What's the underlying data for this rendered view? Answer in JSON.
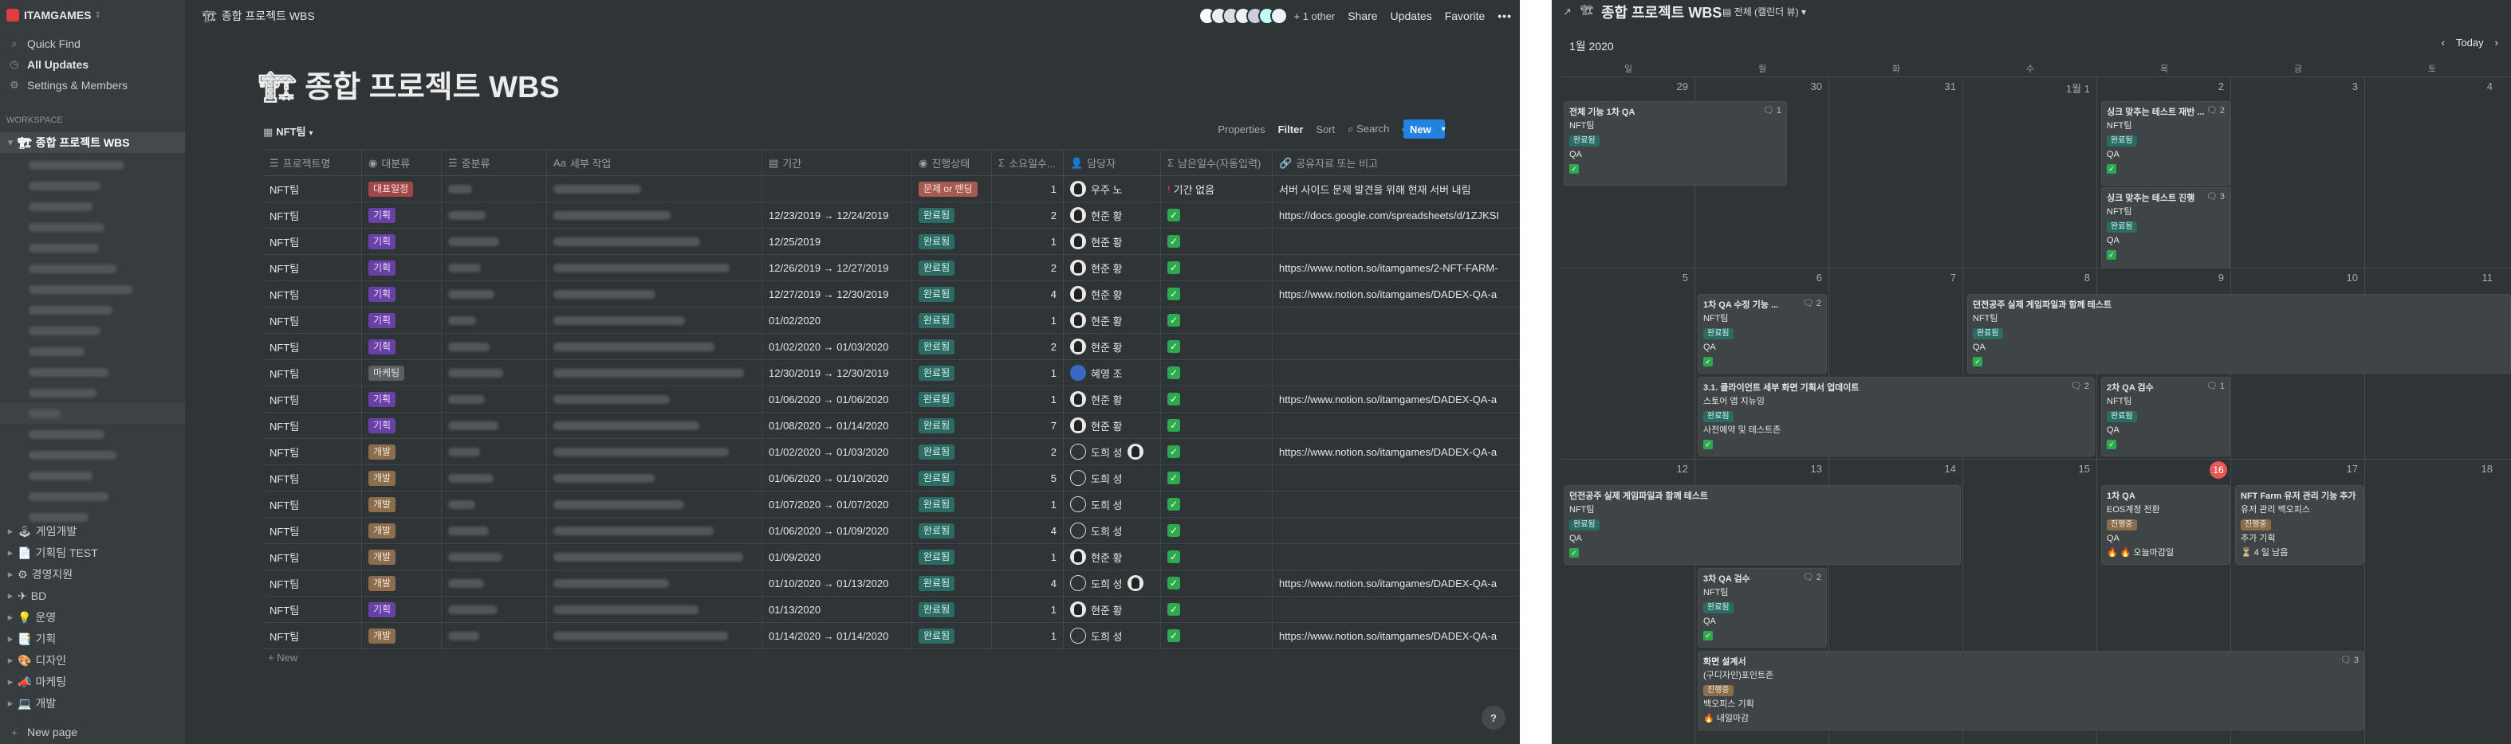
{
  "workspace": {
    "name": "ITAMGAMES"
  },
  "sidebar": {
    "quick_find": "Quick Find",
    "all_updates": "All Updates",
    "settings": "Settings & Members",
    "section_label": "WORKSPACE",
    "current_page": "종합 프로젝트 WBS",
    "pages": [
      {
        "label": "게임개발"
      },
      {
        "label": "기획팀 TEST"
      },
      {
        "label": "경영지원"
      },
      {
        "label": "BD"
      },
      {
        "label": "운영"
      },
      {
        "label": "기획"
      },
      {
        "label": "디자인"
      },
      {
        "label": "마케팅"
      },
      {
        "label": "개발"
      }
    ],
    "new_page": "New page"
  },
  "topbar": {
    "breadcrumb": "종합 프로젝트 WBS",
    "other_count": "+ 1 other",
    "share": "Share",
    "updates": "Updates",
    "favorite": "Favorite"
  },
  "page": {
    "title": "종합 프로젝트 WBS"
  },
  "view": {
    "name": "NFT팀",
    "properties": "Properties",
    "filter": "Filter",
    "sort": "Sort",
    "search": "Search",
    "new": "New"
  },
  "table": {
    "columns": [
      "프로젝트명",
      "대분류",
      "중분류",
      "세부 작업",
      "기간",
      "진행상태",
      "소요일수...",
      "담당자",
      "남은일수(자동입력)",
      "공유자료 또는 비고"
    ],
    "rows": [
      {
        "project": "NFT팀",
        "cat": "대표일정",
        "cat_style": "red",
        "period": "",
        "status": "문제 or 랜딩",
        "status_style": "prob",
        "days": "1",
        "owner": "우주 노",
        "owner_style": "dark",
        "remain": "기간 없음",
        "note": "서버 사이드 문제 발견을 위해 현재 서버 내림"
      },
      {
        "project": "NFT팀",
        "cat": "기획",
        "cat_style": "gi",
        "period": "12/23/2019 → 12/24/2019",
        "status": "완료됨",
        "status_style": "done",
        "days": "2",
        "owner": "현준 황",
        "owner_style": "dark",
        "remain": "",
        "note": "https://docs.google.com/spreadsheets/d/1ZJKSI"
      },
      {
        "project": "NFT팀",
        "cat": "기획",
        "cat_style": "gi",
        "period": "12/25/2019",
        "status": "완료됨",
        "status_style": "done",
        "days": "1",
        "owner": "현준 황",
        "owner_style": "dark",
        "remain": "",
        "note": ""
      },
      {
        "project": "NFT팀",
        "cat": "기획",
        "cat_style": "gi",
        "period": "12/26/2019 → 12/27/2019",
        "status": "완료됨",
        "status_style": "done",
        "days": "2",
        "owner": "현준 황",
        "owner_style": "dark",
        "remain": "",
        "note": "https://www.notion.so/itamgames/2-NFT-FARM-"
      },
      {
        "project": "NFT팀",
        "cat": "기획",
        "cat_style": "gi",
        "period": "12/27/2019 → 12/30/2019",
        "status": "완료됨",
        "status_style": "done",
        "days": "4",
        "owner": "현준 황",
        "owner_style": "dark",
        "remain": "",
        "note": "https://www.notion.so/itamgames/DADEX-QA-a"
      },
      {
        "project": "NFT팀",
        "cat": "기획",
        "cat_style": "gi",
        "period": "01/02/2020",
        "status": "완료됨",
        "status_style": "done",
        "days": "1",
        "owner": "현준 황",
        "owner_style": "dark",
        "remain": "",
        "note": ""
      },
      {
        "project": "NFT팀",
        "cat": "기획",
        "cat_style": "gi",
        "period": "01/02/2020 → 01/03/2020",
        "status": "완료됨",
        "status_style": "done",
        "days": "2",
        "owner": "현준 황",
        "owner_style": "dark",
        "remain": "",
        "note": ""
      },
      {
        "project": "NFT팀",
        "cat": "마케팅",
        "cat_style": "mk",
        "period": "12/30/2019 → 12/30/2019",
        "status": "완료됨",
        "status_style": "done",
        "days": "1",
        "owner": "혜영 조",
        "owner_style": "blue",
        "remain": "",
        "note": ""
      },
      {
        "project": "NFT팀",
        "cat": "기획",
        "cat_style": "gi",
        "period": "01/06/2020 → 01/06/2020",
        "status": "완료됨",
        "status_style": "done",
        "days": "1",
        "owner": "현준 황",
        "owner_style": "dark",
        "remain": "",
        "note": "https://www.notion.so/itamgames/DADEX-QA-a"
      },
      {
        "project": "NFT팀",
        "cat": "기획",
        "cat_style": "gi",
        "period": "01/08/2020 → 01/14/2020",
        "status": "완료됨",
        "status_style": "done",
        "days": "7",
        "owner": "현준 황",
        "owner_style": "dark",
        "remain": "",
        "note": ""
      },
      {
        "project": "NFT팀",
        "cat": "개발",
        "cat_style": "dev",
        "period": "01/02/2020 → 01/03/2020",
        "status": "완료됨",
        "status_style": "done",
        "days": "2",
        "owner": "도희 성",
        "owner_style": "out",
        "remain": "",
        "note": "https://www.notion.so/itamgames/DADEX-QA-a"
      },
      {
        "project": "NFT팀",
        "cat": "개발",
        "cat_style": "dev",
        "period": "01/06/2020 → 01/10/2020",
        "status": "완료됨",
        "status_style": "done",
        "days": "5",
        "owner": "도희 성",
        "owner_style": "out",
        "remain": "",
        "note": ""
      },
      {
        "project": "NFT팀",
        "cat": "개발",
        "cat_style": "dev",
        "period": "01/07/2020 → 01/07/2020",
        "status": "완료됨",
        "status_style": "done",
        "days": "1",
        "owner": "도희 성",
        "owner_style": "out",
        "remain": "",
        "note": ""
      },
      {
        "project": "NFT팀",
        "cat": "개발",
        "cat_style": "dev",
        "period": "01/06/2020 → 01/09/2020",
        "status": "완료됨",
        "status_style": "done",
        "days": "4",
        "owner": "도희 성",
        "owner_style": "out",
        "remain": "",
        "note": ""
      },
      {
        "project": "NFT팀",
        "cat": "개발",
        "cat_style": "dev",
        "period": "01/09/2020",
        "status": "완료됨",
        "status_style": "done",
        "days": "1",
        "owner": "현준 황",
        "owner_style": "dark",
        "remain": "",
        "note": ""
      },
      {
        "project": "NFT팀",
        "cat": "개발",
        "cat_style": "dev",
        "period": "01/10/2020 → 01/13/2020",
        "status": "완료됨",
        "status_style": "done",
        "days": "4",
        "owner": "도희 성",
        "owner_style": "out",
        "remain": "",
        "note": "https://www.notion.so/itamgames/DADEX-QA-a"
      },
      {
        "project": "NFT팀",
        "cat": "기획",
        "cat_style": "gi",
        "period": "01/13/2020",
        "status": "완료됨",
        "status_style": "done",
        "days": "1",
        "owner": "현준 황",
        "owner_style": "dark",
        "remain": "",
        "note": ""
      },
      {
        "project": "NFT팀",
        "cat": "개발",
        "cat_style": "dev",
        "period": "01/14/2020 → 01/14/2020",
        "status": "완료됨",
        "status_style": "done",
        "days": "1",
        "owner": "도희 성",
        "owner_style": "out",
        "remain": "",
        "note": "https://www.notion.so/itamgames/DADEX-QA-a"
      }
    ],
    "new_row": "+ New"
  },
  "calendar": {
    "breadcrumb": "종합 프로젝트 WBS",
    "view_name": "전체 (캘린더 뷰)",
    "month": "1월 2020",
    "today": "Today",
    "weekdays": [
      "일",
      "월",
      "화",
      "수",
      "목",
      "금",
      "토"
    ],
    "weeks": [
      [
        "29",
        "30",
        "31",
        "1월 1",
        "2",
        "3",
        "4"
      ],
      [
        "5",
        "6",
        "7",
        "8",
        "9",
        "10",
        "11"
      ],
      [
        "12",
        "13",
        "14",
        "15",
        "16",
        "17",
        "18"
      ]
    ],
    "cards": {
      "c1": {
        "title": "전체 기능 1차 QA",
        "team": "NFT팀",
        "status": "완료됨",
        "role": "QA",
        "comments": "1"
      },
      "c2": {
        "title": "싱크 맞추는 테스트 재반 ...",
        "team": "NFT팀",
        "status": "완료됨",
        "role": "QA",
        "comments": "2"
      },
      "c3": {
        "title": "싱크 맞추는 테스트 진행",
        "team": "NFT팀",
        "status": "완료됨",
        "role": "QA",
        "comments": "3"
      },
      "c4": {
        "title": "1차 QA 수정 기능 ...",
        "team": "NFT팀",
        "status": "완료됨",
        "role": "QA",
        "comments": "2"
      },
      "c5": {
        "title": "던전공주 실제 게임파일과 함께 테스트",
        "team": "NFT팀",
        "status": "완료됨",
        "role": "QA"
      },
      "c6": {
        "title": "3.1. 클라이언트 세부 화면 기획서 업데이트",
        "team": "스토어 앱 지뉴잉",
        "status": "완료됨",
        "role": "사전예약 및 테스트존",
        "comments": "2"
      },
      "c7": {
        "title": "2차 QA 검수",
        "team": "NFT팀",
        "status": "완료됨",
        "role": "QA",
        "comments": "1"
      },
      "c8": {
        "title": "던전공주 실제 게임파일과 함께 테스트",
        "team": "NFT팀",
        "status": "완료됨",
        "role": "QA"
      },
      "c9": {
        "title": "1차 QA",
        "team": "EOS계정 전환",
        "status": "진행중",
        "role": "QA",
        "note": "🔥 🔥 오늘마감일"
      },
      "c10": {
        "title": "NFT Farm 유저 관리 기능 추가",
        "team": "유저 관리 백오피스",
        "status": "진행중",
        "role": "추가 기획",
        "note": "⏳ 4 일 남음"
      },
      "c11": {
        "title": "3차 QA 검수",
        "team": "NFT팀",
        "status": "완료됨",
        "role": "QA",
        "comments": "2"
      },
      "c12": {
        "title": "화면 설계서",
        "team": "(구디자인)포인트존",
        "status": "진행중",
        "role": "백오피스 기획",
        "note": "🔥 내일마감",
        "comments": "3"
      }
    }
  }
}
